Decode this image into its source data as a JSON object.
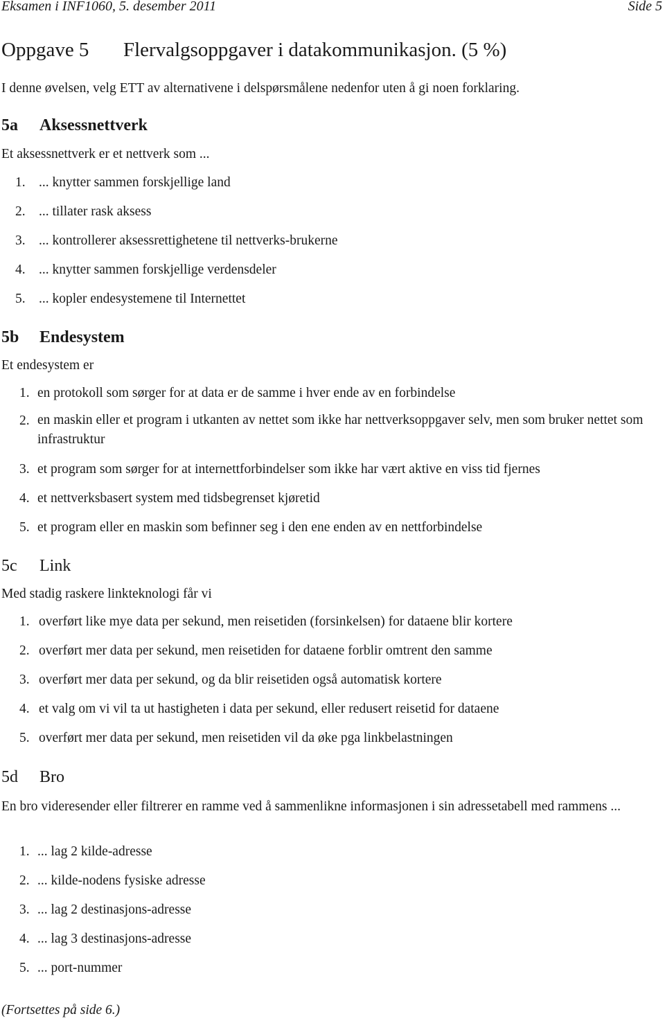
{
  "header": {
    "left": "Eksamen i INF1060, 5. desember 2011",
    "right": "Side 5"
  },
  "task": {
    "number": "Oppgave 5",
    "title": "Flervalgsoppgaver i datakommunikasjon. (5 %)",
    "intro": "I denne øvelsen, velg ETT av alternativene i delspørsmålene nedenfor uten å gi noen forklaring."
  },
  "sections": [
    {
      "id": "5a",
      "title": "Aksessnettverk",
      "prompt": "Et aksessnettverk er et nettverk som ...",
      "options": [
        {
          "n": "1.",
          "text": "... knytter sammen forskjellige land"
        },
        {
          "n": "2.",
          "text": "... tillater rask aksess"
        },
        {
          "n": "3.",
          "text": "... kontrollerer aksessrettighetene til nettverks-brukerne"
        },
        {
          "n": "4.",
          "text": "... knytter sammen forskjellige verdensdeler"
        },
        {
          "n": "5.",
          "text": "... kopler endesystemene til Internettet"
        }
      ]
    },
    {
      "id": "5b",
      "title": "Endesystem",
      "prompt": "Et endesystem er",
      "options": [
        {
          "n": "1.",
          "text": "en protokoll som sørger for at data er de samme i hver ende av en forbindelse"
        },
        {
          "n": "2.",
          "text": "en maskin eller et program i utkanten av nettet som ikke har nettverksoppgaver selv, men som bruker nettet som infrastruktur"
        },
        {
          "n": "3.",
          "text": "et program som sørger for at internettforbindelser som ikke har vært aktive en viss tid fjernes"
        },
        {
          "n": "4.",
          "text": "et nettverksbasert system med tidsbegrenset kjøretid"
        },
        {
          "n": "5.",
          "text": "et program eller en maskin som befinner seg i den ene enden av en nettforbindelse"
        }
      ]
    },
    {
      "id": "5c",
      "title": "Link",
      "prompt": "Med stadig raskere linkteknologi får vi",
      "options": [
        {
          "n": "1.",
          "text": "overført like mye data per sekund, men reisetiden (forsinkelsen) for dataene blir kortere"
        },
        {
          "n": "2.",
          "text": "overført mer data per sekund, men reisetiden for dataene forblir omtrent den samme"
        },
        {
          "n": "3.",
          "text": "overført mer data per sekund, og da blir reisetiden også automatisk kortere"
        },
        {
          "n": "4.",
          "text": "et valg om vi vil ta ut hastigheten i data per sekund, eller redusert reisetid for dataene"
        },
        {
          "n": "5.",
          "text": "overført mer data per sekund, men reisetiden vil da øke pga linkbelastningen"
        }
      ]
    },
    {
      "id": "5d",
      "title": "Bro",
      "prompt": "En bro videresender eller filtrerer en ramme ved å sammenlikne informasjonen i sin adressetabell med rammens ...",
      "options": [
        {
          "n": "1.",
          "text": "... lag 2 kilde-adresse"
        },
        {
          "n": "2.",
          "text": "... kilde-nodens fysiske adresse"
        },
        {
          "n": "3.",
          "text": "... lag 2 destinasjons-adresse"
        },
        {
          "n": "4.",
          "text": "... lag 3 destinasjons-adresse"
        },
        {
          "n": "5.",
          "text": "... port-nummer"
        }
      ]
    }
  ],
  "footer": "(Fortsettes på side 6.)"
}
